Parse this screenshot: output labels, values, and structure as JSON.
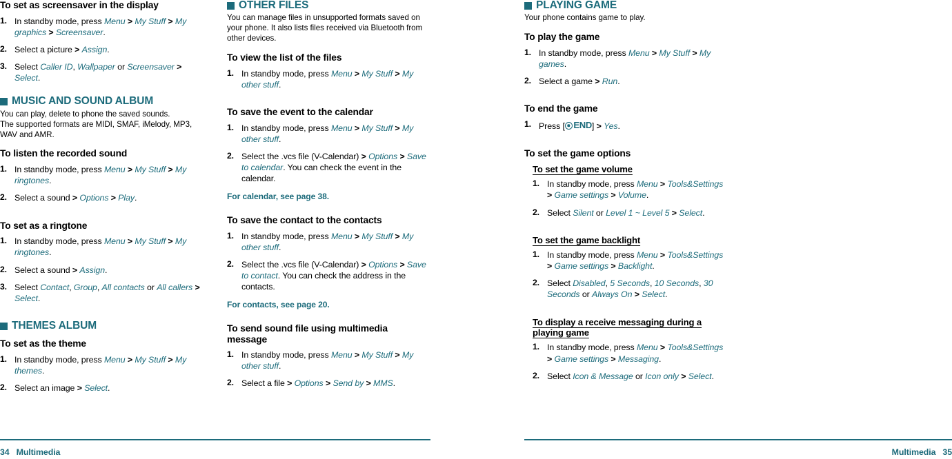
{
  "colors": {
    "accent": "#1c6b7b",
    "text": "#000000",
    "background": "#ffffff"
  },
  "footer": {
    "left": "34   Multimedia",
    "right": "Multimedia   35"
  },
  "column1": {
    "proc_screensaver": {
      "heading": "To set as screensaver in the display",
      "steps": [
        {
          "num": "1.",
          "html": "In standby mode, press <i class=\"m\">Menu</i> <span class=\"gt\">&gt;</span> <i class=\"m\">My Stuff</i> <span class=\"gt\">&gt;</span> <i class=\"m\">My graphics</i> <span class=\"gt\">&gt;</span> <i class=\"m\">Screensaver</i>."
        },
        {
          "num": "2.",
          "html": "Select a picture <span class=\"gt\">&gt;</span> <i class=\"m\">Assign</i>."
        },
        {
          "num": "3.",
          "html": "Select <i class=\"m\">Caller ID</i>, <i class=\"m\">Wallpaper</i> or <i class=\"m\">Screensaver</i> <span class=\"gt\">&gt;</span> <i class=\"m\">Select</i>."
        }
      ]
    },
    "section_music": {
      "title": "MUSIC AND SOUND ALBUM",
      "intro": "You can play, delete to phone the saved sounds.\nThe supported formats are MIDI, SMAF, iMelody, MP3, WAV and AMR."
    },
    "proc_listen": {
      "heading": "To listen the recorded sound",
      "steps": [
        {
          "num": "1.",
          "html": "In standby mode, press <i class=\"m\">Menu</i> <span class=\"gt\">&gt;</span> <i class=\"m\">My Stuff</i> <span class=\"gt\">&gt;</span> <i class=\"m\">My ringtones</i>."
        },
        {
          "num": "2.",
          "html": "Select a sound <span class=\"gt\">&gt;</span> <i class=\"m\">Options</i> <span class=\"gt\">&gt;</span> <i class=\"m\">Play</i>."
        }
      ]
    },
    "proc_ringtone": {
      "heading": "To set as a ringtone",
      "steps": [
        {
          "num": "1.",
          "html": "In standby mode, press <i class=\"m\">Menu</i> <span class=\"gt\">&gt;</span> <i class=\"m\">My Stuff</i> <span class=\"gt\">&gt;</span> <i class=\"m\">My ringtones</i>."
        },
        {
          "num": "2.",
          "html": "Select a sound <span class=\"gt\">&gt;</span> <i class=\"m\">Assign</i>."
        },
        {
          "num": "3.",
          "html": "Select <i class=\"m\">Contact</i>, <i class=\"m\">Group</i>, <i class=\"m\">All contacts</i> or <i class=\"m\">All callers</i> <span class=\"gt\">&gt;</span> <i class=\"m\">Select</i>."
        }
      ]
    },
    "section_themes": {
      "title": "THEMES ALBUM"
    },
    "proc_theme": {
      "heading": "To set as the theme",
      "steps": [
        {
          "num": "1.",
          "html": "In standby mode, press <i class=\"m\">Menu</i> <span class=\"gt\">&gt;</span> <i class=\"m\">My Stuff</i> <span class=\"gt\">&gt;</span> <i class=\"m\">My themes</i>."
        },
        {
          "num": "2.",
          "html": "Select an image <span class=\"gt\">&gt;</span> <i class=\"m\">Select</i>."
        }
      ]
    }
  },
  "column2": {
    "section_other_files": {
      "title": "OTHER FILES",
      "intro": "You can manage files in unsupported formats saved on your phone. It also lists files received via Bluetooth from other devices."
    },
    "proc_view_list": {
      "heading": "To view the list of the files",
      "steps": [
        {
          "num": "1.",
          "html": "In standby mode, press <i class=\"m\">Menu</i> <span class=\"gt\">&gt;</span> <i class=\"m\">My Stuff</i> <span class=\"gt\">&gt;</span> <i class=\"m\">My other stuff</i>."
        }
      ]
    },
    "proc_save_event": {
      "heading": "To save the event to the calendar",
      "steps": [
        {
          "num": "1.",
          "html": "In standby mode, press <i class=\"m\">Menu</i> <span class=\"gt\">&gt;</span> <i class=\"m\">My Stuff</i> <span class=\"gt\">&gt;</span> <i class=\"m\">My other stuff</i>."
        },
        {
          "num": "2.",
          "html": "Select the .vcs file (V-Calendar) <span class=\"gt\">&gt;</span> <i class=\"m\">Options</i> <span class=\"gt\">&gt;</span> <i class=\"m\">Save to calendar</i>. You can check the event in the calendar."
        }
      ],
      "xref": "For calendar, see page 38."
    },
    "proc_save_contact": {
      "heading": "To save the contact to the contacts",
      "steps": [
        {
          "num": "1.",
          "html": "In standby mode, press <i class=\"m\">Menu</i> <span class=\"gt\">&gt;</span> <i class=\"m\">My Stuff</i> <span class=\"gt\">&gt;</span> <i class=\"m\">My other stuff</i>."
        },
        {
          "num": "2.",
          "html": "Select the .vcs file (V-Calendar) <span class=\"gt\">&gt;</span> <i class=\"m\">Options</i> <span class=\"gt\">&gt;</span> <i class=\"m\">Save to contact</i>. You can check the address in the contacts."
        }
      ],
      "xref": "For contacts, see page 20."
    },
    "proc_send_sound": {
      "heading": "To send sound file using multimedia message",
      "steps": [
        {
          "num": "1.",
          "html": "In standby mode, press <i class=\"m\">Menu</i> <span class=\"gt\">&gt;</span> <i class=\"m\">My Stuff</i> <span class=\"gt\">&gt;</span> <i class=\"m\">My other stuff</i>."
        },
        {
          "num": "2.",
          "html": "Select a file <span class=\"gt\">&gt;</span> <i class=\"m\">Options</i> <span class=\"gt\">&gt;</span> <i class=\"m\">Send by</i> <span class=\"gt\">&gt;</span> <i class=\"m\">MMS</i>."
        }
      ]
    }
  },
  "column3": {
    "section_playing_game": {
      "title": "PLAYING GAME",
      "intro": "Your phone contains game to play."
    },
    "proc_play_game": {
      "heading": "To play the game",
      "steps": [
        {
          "num": "1.",
          "html": "In standby mode, press <i class=\"m\">Menu</i> <span class=\"gt\">&gt;</span> <i class=\"m\">My Stuff</i> <span class=\"gt\">&gt;</span> <i class=\"m\">My games</i>."
        },
        {
          "num": "2.",
          "html": "Select a game <span class=\"gt\">&gt;</span> <i class=\"m\">Run</i>."
        }
      ]
    },
    "proc_end_game": {
      "heading": "To end the game",
      "step_prefix": "Press [",
      "endkey_label": "END",
      "step_suffix_html": "] <span class=\"gt\">&gt;</span> <i class=\"m\">Yes</i>.",
      "step_num": "1."
    },
    "proc_game_options": {
      "heading": "To set the game options"
    },
    "sub_volume": {
      "heading": "To set the game volume",
      "steps": [
        {
          "num": "1.",
          "html": "In standby mode, press <i class=\"m\">Menu</i> <span class=\"gt\">&gt;</span> <i class=\"m\">Tools&amp;Settings</i> <span class=\"gt\">&gt;</span> <i class=\"m\">Game settings</i> <span class=\"gt\">&gt;</span> <i class=\"m\">Volume</i>."
        },
        {
          "num": "2.",
          "html": "Select <i class=\"m\">Silent</i> or <i class=\"m\">Level 1 ~ Level 5</i> <span class=\"gt\">&gt;</span> <i class=\"m\">Select</i>."
        }
      ]
    },
    "sub_backlight": {
      "heading": "To set the game backlight",
      "steps": [
        {
          "num": "1.",
          "html": "In standby mode, press <i class=\"m\">Menu</i> <span class=\"gt\">&gt;</span> <i class=\"m\">Tools&amp;Settings</i> <span class=\"gt\">&gt;</span> <i class=\"m\">Game settings</i> <span class=\"gt\">&gt;</span> <i class=\"m\">Backlight</i>."
        },
        {
          "num": "2.",
          "html": "Select <i class=\"m\">Disabled</i>, <i class=\"m\">5 Seconds</i>, <i class=\"m\">10 Seconds</i>, <i class=\"m\">30 Seconds</i> or <i class=\"m\">Always On</i> <span class=\"gt\">&gt;</span> <i class=\"m\">Select</i>."
        }
      ]
    },
    "sub_messaging": {
      "heading": "To display a receive messaging during a playing game",
      "steps": [
        {
          "num": "1.",
          "html": "In standby mode, press <i class=\"m\">Menu</i> <span class=\"gt\">&gt;</span> <i class=\"m\">Tools&amp;Settings</i> <span class=\"gt\">&gt;</span> <i class=\"m\">Game settings</i> <span class=\"gt\">&gt;</span> <i class=\"m\">Messaging</i>."
        },
        {
          "num": "2.",
          "html": "Select <i class=\"m\">Icon &amp; Message</i> or <i class=\"m\">Icon only</i> <span class=\"gt\">&gt;</span> <i class=\"m\">Select</i>."
        }
      ]
    }
  }
}
